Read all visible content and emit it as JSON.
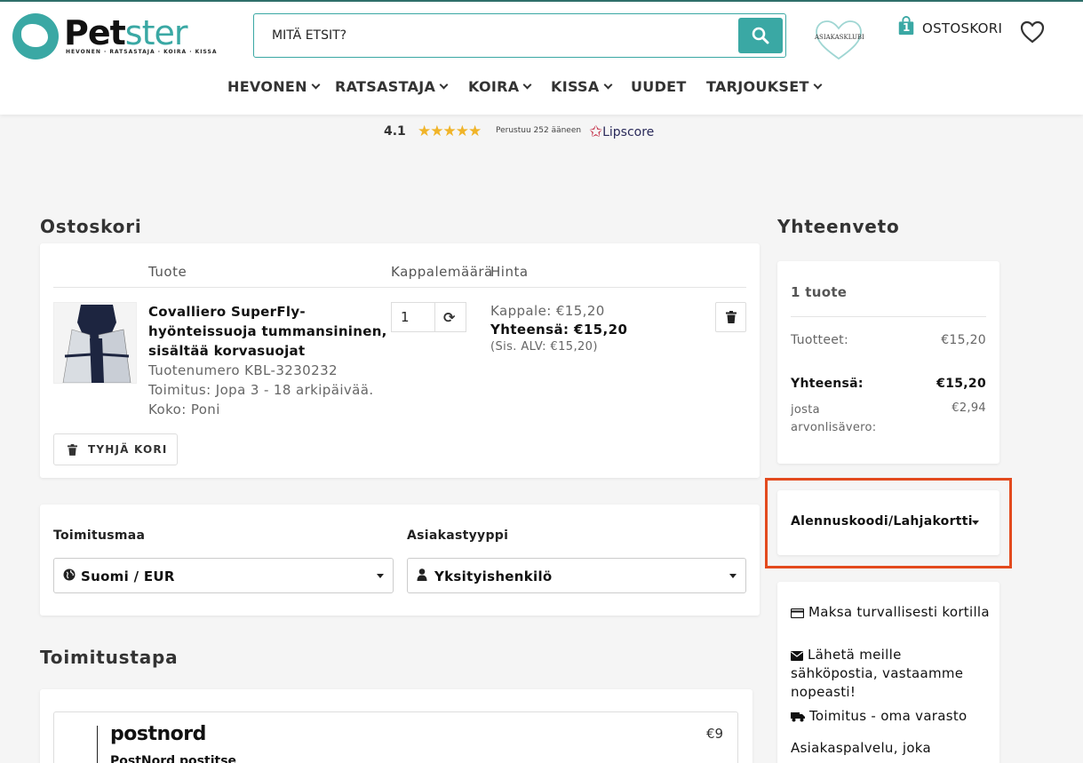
{
  "header": {
    "logo_name": "Petster",
    "logo_part1": "Pet",
    "logo_part2": "ster",
    "logo_tagline": "HEVONEN · RATSASTAJA · KOIRA · KISSA",
    "search_placeholder": "MITÄ ETSIT?",
    "club_label": "ASIAKASKLUBI",
    "cart_count": "1",
    "cart_label": "OSTOSKORI",
    "accent_color": "#3aa8a4"
  },
  "nav": [
    {
      "label": "HEVONEN",
      "dropdown": true
    },
    {
      "label": "RATSASTAJA",
      "dropdown": true
    },
    {
      "label": "KOIRA",
      "dropdown": true
    },
    {
      "label": "KISSA",
      "dropdown": true
    },
    {
      "label": "UUDET",
      "dropdown": false
    },
    {
      "label": "TARJOUKSET",
      "dropdown": true
    }
  ],
  "rating": {
    "score": "4.1",
    "stars": "★★★★★",
    "based_on": "Perustuu 252 ääneen",
    "provider": "Lipscore"
  },
  "cart": {
    "heading": "Ostoskori",
    "col_product": "Tuote",
    "col_qty": "Kappalemäärä",
    "col_price": "Hinta",
    "item": {
      "name": "Covalliero SuperFly-hyönteissuoja tummansininen, sisältää korvasuojat",
      "sku": "Tuotenumero KBL-3230232",
      "delivery": "Toimitus: Jopa 3 - 18 arkipäivää.",
      "size": "Koko: Poni",
      "quantity": "1",
      "unit_price": "Kappale: €15,20",
      "total": "Yhteensä: €15,20",
      "vat": "(Sis. ALV: €15,20)"
    },
    "empty_label": "TYHJÄ KORI"
  },
  "delivery_country": {
    "country_label": "Toimitusmaa",
    "country_value": "Suomi / EUR",
    "type_label": "Asiakastyyppi",
    "type_value": "Yksityishenkilö"
  },
  "delivery_method": {
    "heading": "Toimitustapa",
    "carrier_logo": "postnord",
    "price": "€9",
    "name": "PostNord postitse"
  },
  "summary": {
    "heading": "Yhteenveto",
    "item_count": "1 tuote",
    "products_label": "Tuotteet:",
    "products_value": "€15,20",
    "total_label": "Yhteensä:",
    "total_value": "€15,20",
    "vat_label": "josta arvonlisävero:",
    "vat_value": "€2,94"
  },
  "discount": {
    "label": "Alennuskoodi/Lahjakortti",
    "highlight_color": "#e34a1e"
  },
  "info": {
    "pay": "Maksa turvallisesti kortilla",
    "email": "Lähetä meille sähköpostia, vastaamme nopeasti!",
    "shipping": "Toimitus - oma varasto",
    "service": "Asiakaspalvelu, joka"
  }
}
